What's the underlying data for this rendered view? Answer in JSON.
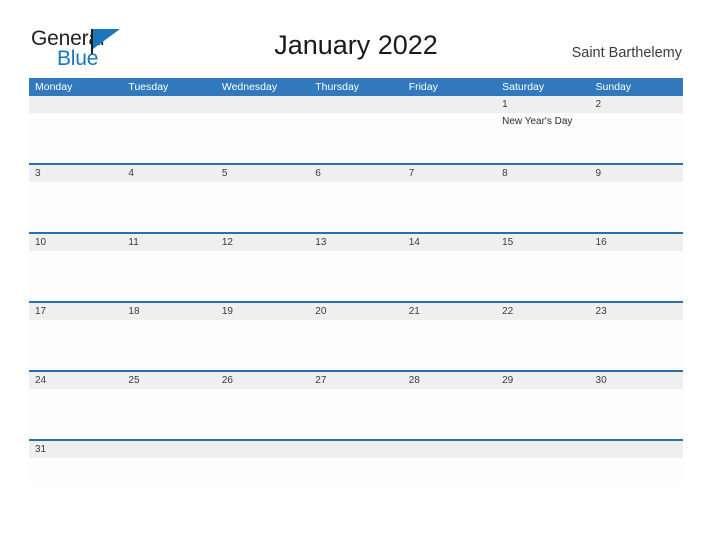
{
  "brand": {
    "word_one": "General",
    "word_two": "Blue",
    "flag_icon": "flag-triangle-icon",
    "accent_color": "#1b76bc",
    "text_color": "#231f20"
  },
  "header": {
    "title": "January 2022",
    "location": "Saint Barthelemy"
  },
  "colors": {
    "header_blue": "#3179bc",
    "row_separator_blue": "#2a6ead",
    "date_strip_gray": "#efefef",
    "cell_white": "#fdfdfd"
  },
  "calendar": {
    "weekday_headers": [
      "Monday",
      "Tuesday",
      "Wednesday",
      "Thursday",
      "Friday",
      "Saturday",
      "Sunday"
    ],
    "weeks": [
      {
        "dates": [
          "",
          "",
          "",
          "",
          "",
          "1",
          "2"
        ],
        "events": [
          "",
          "",
          "",
          "",
          "",
          "New Year's Day",
          ""
        ]
      },
      {
        "dates": [
          "3",
          "4",
          "5",
          "6",
          "7",
          "8",
          "9"
        ],
        "events": [
          "",
          "",
          "",
          "",
          "",
          "",
          ""
        ]
      },
      {
        "dates": [
          "10",
          "11",
          "12",
          "13",
          "14",
          "15",
          "16"
        ],
        "events": [
          "",
          "",
          "",
          "",
          "",
          "",
          ""
        ]
      },
      {
        "dates": [
          "17",
          "18",
          "19",
          "20",
          "21",
          "22",
          "23"
        ],
        "events": [
          "",
          "",
          "",
          "",
          "",
          "",
          ""
        ]
      },
      {
        "dates": [
          "24",
          "25",
          "26",
          "27",
          "28",
          "29",
          "30"
        ],
        "events": [
          "",
          "",
          "",
          "",
          "",
          "",
          ""
        ]
      },
      {
        "dates": [
          "31",
          "",
          "",
          "",
          "",
          "",
          ""
        ],
        "events": [
          "",
          "",
          "",
          "",
          "",
          "",
          ""
        ]
      }
    ]
  }
}
